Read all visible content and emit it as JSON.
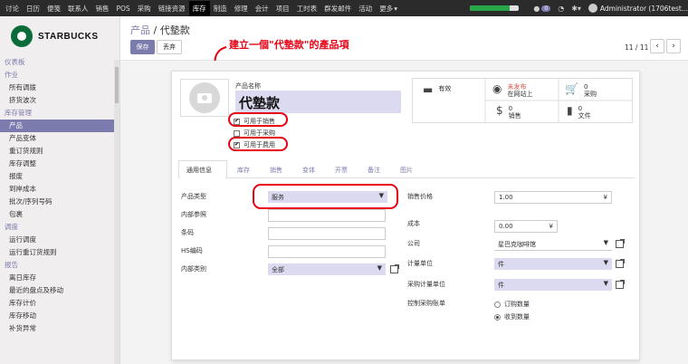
{
  "topbar": {
    "menu": [
      "讨论",
      "日历",
      "便笺",
      "联系人",
      "销售",
      "POS",
      "采购",
      "链接资源",
      "库存",
      "制造",
      "修理",
      "会计",
      "项目",
      "工时表",
      "群发邮件",
      "活动",
      "更多"
    ],
    "active": "库存",
    "progress": 0.8,
    "badge": "0",
    "user": "Administrator (1706test..."
  },
  "sidebar": {
    "brand": "STARBUCKS",
    "items": [
      {
        "label": "仪表板",
        "type": "sec"
      },
      {
        "label": "作业",
        "type": "sec"
      },
      {
        "label": "所有调拨",
        "type": "it"
      },
      {
        "label": "挤货波次",
        "type": "it"
      },
      {
        "label": "库存管理",
        "type": "sec"
      },
      {
        "label": "产品",
        "type": "it",
        "active": true
      },
      {
        "label": "产品变体",
        "type": "it"
      },
      {
        "label": "重订货规则",
        "type": "it"
      },
      {
        "label": "库存调整",
        "type": "it"
      },
      {
        "label": "报废",
        "type": "it"
      },
      {
        "label": "到岸成本",
        "type": "it"
      },
      {
        "label": "批次/序列号码",
        "type": "it"
      },
      {
        "label": "包裹",
        "type": "it"
      },
      {
        "label": "调度",
        "type": "sec"
      },
      {
        "label": "运行调度",
        "type": "it"
      },
      {
        "label": "运行重订货规则",
        "type": "it"
      },
      {
        "label": "报告",
        "type": "sec"
      },
      {
        "label": "离日库存",
        "type": "it"
      },
      {
        "label": "最近的盘点及移动",
        "type": "it"
      },
      {
        "label": "库存计价",
        "type": "it"
      },
      {
        "label": "库存移动",
        "type": "it"
      },
      {
        "label": "补货异常",
        "type": "it"
      }
    ]
  },
  "control": {
    "breadcrumb_parent": "产品",
    "breadcrumb_sep": "/",
    "breadcrumb_current": "代墊款",
    "save": "保存",
    "discard": "丢弃",
    "pager": "11 / 11",
    "prev": "‹",
    "next": "›"
  },
  "annotation": "建立一個\"代墊款\"的產品項",
  "form": {
    "name_label": "产品名称",
    "name": "代墊款",
    "can_sell": {
      "label": "可用于销售",
      "checked": true
    },
    "can_purchase": {
      "label": "可用于采购",
      "checked": false
    },
    "can_expense": {
      "label": "可用于费用",
      "checked": true
    },
    "stats": {
      "active": "有效",
      "published_1": "未发布",
      "published_2": "在网站上",
      "purchases_count": "0",
      "purchases_label": "采购",
      "sales_count": "0",
      "sales_label": "销售",
      "docs_count": "0",
      "docs_label": "文件"
    },
    "tabs": [
      "通用信息",
      "库存",
      "销售",
      "变体",
      "开票",
      "备注",
      "图片"
    ],
    "left": {
      "type_label": "产品类型",
      "type_value": "服务",
      "ref_label": "内部参照",
      "barcode_label": "条码",
      "hs_label": "HS编码",
      "category_label": "内部类别",
      "category_value": "全部"
    },
    "right": {
      "price_label": "销售价格",
      "price_value": "1.00",
      "price_currency": "¥",
      "cost_label": "成本",
      "cost_value": "0.00",
      "cost_currency": "¥",
      "company_label": "公司",
      "company_value": "星巴克咖啡馆",
      "uom_label": "计量单位",
      "uom_value": "件",
      "po_uom_label": "采购计量单位",
      "po_uom_value": "件",
      "control_label": "控制采购账单",
      "control_opt1": "订购数量",
      "control_opt2": "收到数量"
    }
  },
  "colors": {
    "accent": "#7c7bad",
    "annotation": "#e60012",
    "topbar": "#2b2b2b"
  }
}
